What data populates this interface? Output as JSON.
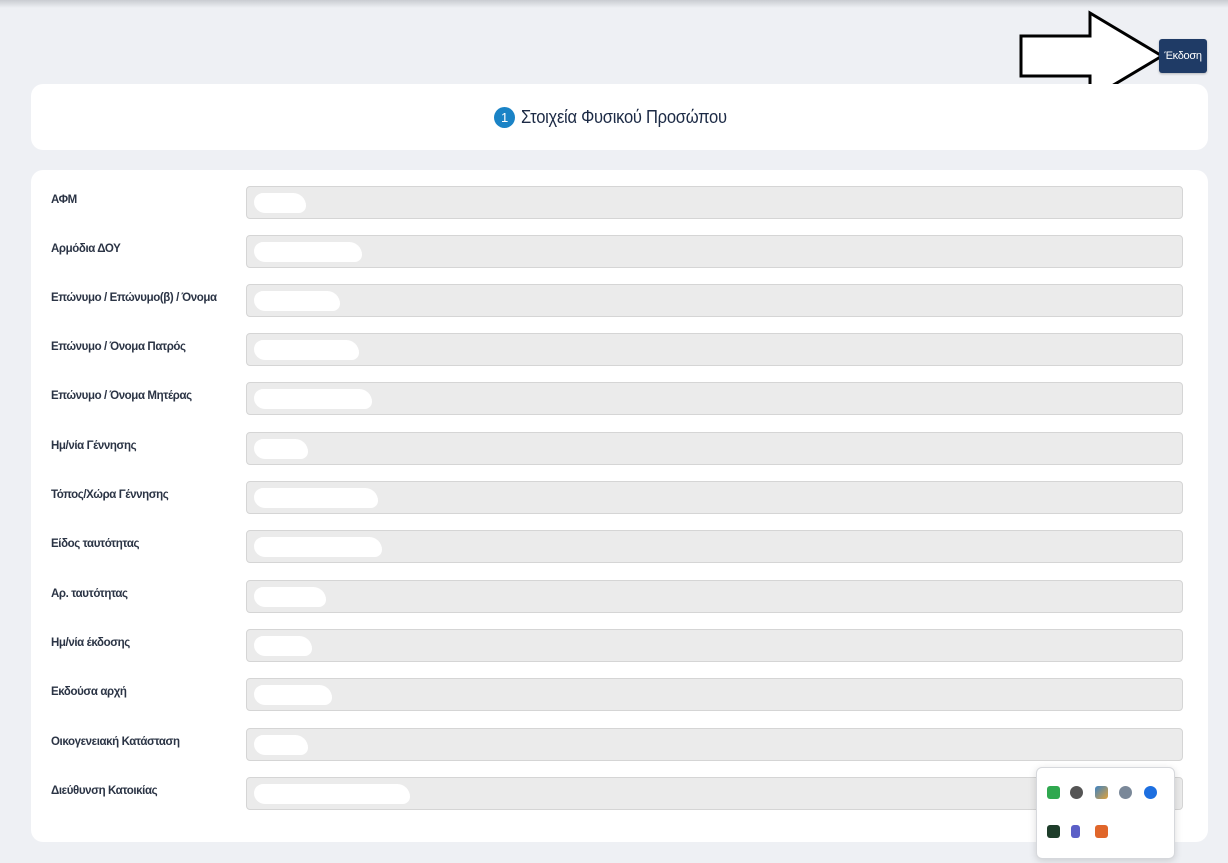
{
  "toolbar": {
    "issue_label": "Έκδοση"
  },
  "header": {
    "step_number": "1",
    "title": "Στοιχεία Φυσικού Προσώπου"
  },
  "form": {
    "fields": [
      {
        "label": "ΑΦΜ",
        "value": ""
      },
      {
        "label": "Αρμόδια ΔΟΥ",
        "value": ""
      },
      {
        "label": "Επώνυμο / Επώνυμο(β) / Όνομα",
        "value": ""
      },
      {
        "label": "Επώνυμο / Όνομα Πατρός",
        "value": ""
      },
      {
        "label": "Επώνυμο / Όνομα Μητέρας",
        "value": ""
      },
      {
        "label": "Ημ/νία Γέννησης",
        "value": ""
      },
      {
        "label": "Τόπος/Χώρα Γέννησης",
        "value": ""
      },
      {
        "label": "Είδος ταυτότητας",
        "value": ""
      },
      {
        "label": "Αρ. ταυτότητας",
        "value": ""
      },
      {
        "label": "Ημ/νία έκδοσης",
        "value": ""
      },
      {
        "label": "Εκδούσα αρχή",
        "value": ""
      },
      {
        "label": "Οικογενειακή Κατάσταση",
        "value": ""
      },
      {
        "label": "Διεύθυνση Κατοικίας",
        "value": ""
      }
    ]
  },
  "tray": {
    "icons": [
      "green-app-icon",
      "tools-icon",
      "palette-icon",
      "globe-icon",
      "blue-z-icon",
      "terminal-icon",
      "teams-icon",
      "orange-app-icon"
    ]
  },
  "colors": {
    "accent": "#1a83c6",
    "button": "#1f3b66",
    "background": "#eef0f4"
  }
}
